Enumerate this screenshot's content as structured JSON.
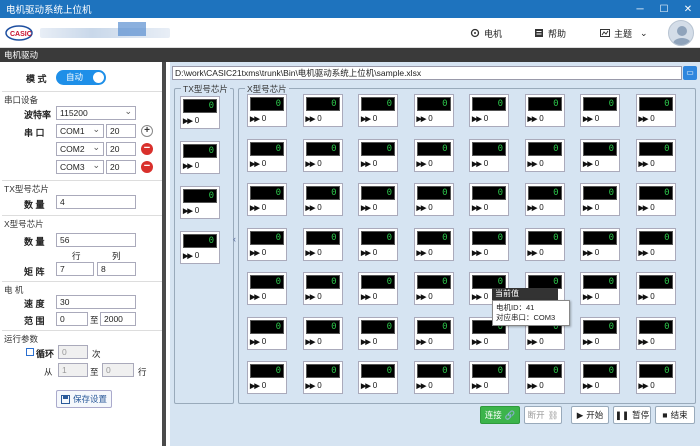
{
  "window": {
    "title": "电机驱动系统上位机",
    "controls": [
      "─",
      "☐",
      "✕"
    ]
  },
  "header": {
    "nav": [
      {
        "label": "电机",
        "icon": "motor-icon"
      },
      {
        "label": "帮助",
        "icon": "help-icon"
      },
      {
        "label": "主题",
        "icon": "theme-icon"
      }
    ]
  },
  "subbar": {
    "title": "电机驱动"
  },
  "left": {
    "mode_label": "模  式",
    "mode_value": "自动",
    "serial_section": "串口设备",
    "baud_label": "波特率",
    "baud_value": "115200",
    "port_label": "串  口",
    "ports": [
      {
        "name": "COM1",
        "value": "20"
      },
      {
        "name": "COM2",
        "value": "20"
      },
      {
        "name": "COM3",
        "value": "20"
      }
    ],
    "tx_section": "TX型号芯片",
    "tx_count_label": "数  量",
    "tx_count_value": "4",
    "x_section": "X型号芯片",
    "x_count_label": "数  量",
    "x_count_value": "56",
    "row_label": "行",
    "col_label": "列",
    "matrix_label": "矩  阵",
    "matrix_rows": "7",
    "matrix_cols": "8",
    "motor_section": "电    机",
    "speed_label": "速  度",
    "speed_value": "30",
    "range_label": "范  围",
    "range_min": "0",
    "range_to": "至",
    "range_max": "2000",
    "run_section": "运行参数",
    "loop_label": "循环",
    "loop_value": "0",
    "loop_unit": "次",
    "from_label": "从",
    "from_value": "1",
    "from_to": "至",
    "to_value": "0",
    "row_unit": "行",
    "save_label": "保存设置"
  },
  "main": {
    "path": "D:\\work\\CASIC21txms\\trunk\\Bin\\电机驱动系统上位机\\sample.xlsx",
    "tx_group": "TX型号芯片",
    "x_group": "X型号芯片",
    "lcd_value": "0",
    "count_value": "0",
    "tooltip": {
      "title": "当前值",
      "motor_id": "电机ID：41",
      "port": "对应串口：COM3"
    },
    "buttons": {
      "connect": "连接",
      "disconnect": "断开",
      "start": "开始",
      "pause": "暂停",
      "end": "结束"
    }
  },
  "colors": {
    "title_bar": "#1e73be",
    "lcd_digit": "#2cc44a",
    "connect_btn": "#3cb44b",
    "toggle": "#1e8fe8"
  }
}
